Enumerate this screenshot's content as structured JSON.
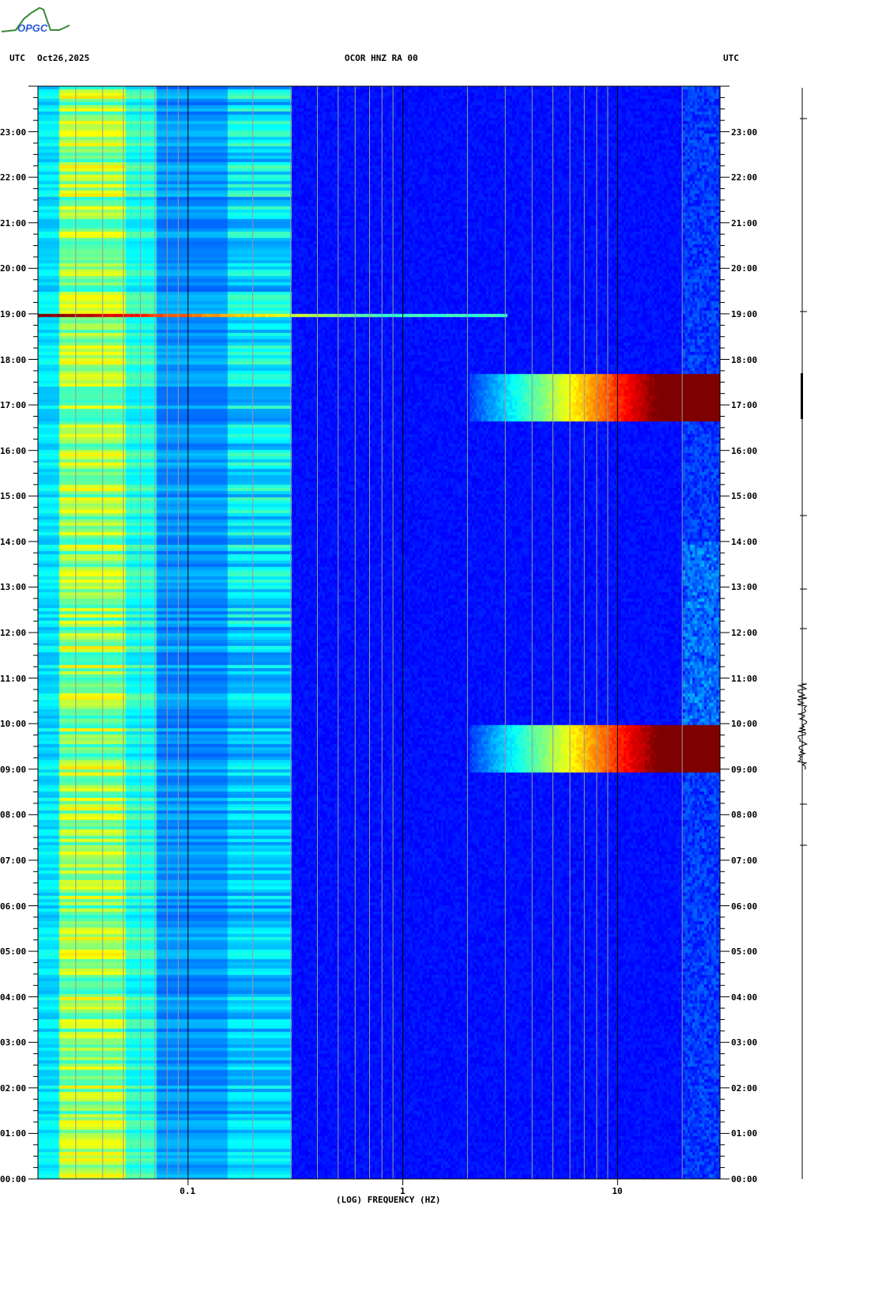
{
  "header": {
    "left_tz": "UTC",
    "date": "Oct26,2025",
    "station": "OCOR HNZ RA 00",
    "right_tz": "UTC",
    "logo_text": "OPGC"
  },
  "chart_data": {
    "type": "heatmap",
    "title": "OCOR HNZ RA 00",
    "xlabel": "(LOG) FREQUENCY (HZ)",
    "x_scale": "log",
    "xlim": [
      0.02,
      30
    ],
    "x_ticks": [
      {
        "value": 0.1,
        "label": "0.1"
      },
      {
        "value": 1,
        "label": "1"
      },
      {
        "value": 10,
        "label": "10"
      }
    ],
    "ylabel": "UTC",
    "ylim_hours": [
      0,
      24
    ],
    "y_ticks": [
      "00:00",
      "01:00",
      "02:00",
      "03:00",
      "04:00",
      "05:00",
      "06:00",
      "07:00",
      "08:00",
      "09:00",
      "10:00",
      "11:00",
      "12:00",
      "13:00",
      "14:00",
      "15:00",
      "16:00",
      "17:00",
      "18:00",
      "19:00",
      "20:00",
      "21:00",
      "22:00",
      "23:00"
    ],
    "colormap": "jet",
    "events": [
      {
        "start_h": 18.95,
        "end_h": 19.05,
        "fmin": 0.02,
        "fmax": 3,
        "level": "strong"
      },
      {
        "start_h": 16.67,
        "end_h": 17.68,
        "fmin": 2,
        "fmax": 30,
        "level": "strong"
      },
      {
        "start_h": 8.95,
        "end_h": 10.0,
        "fmin": 2,
        "fmax": 30,
        "level": "strong"
      }
    ]
  }
}
